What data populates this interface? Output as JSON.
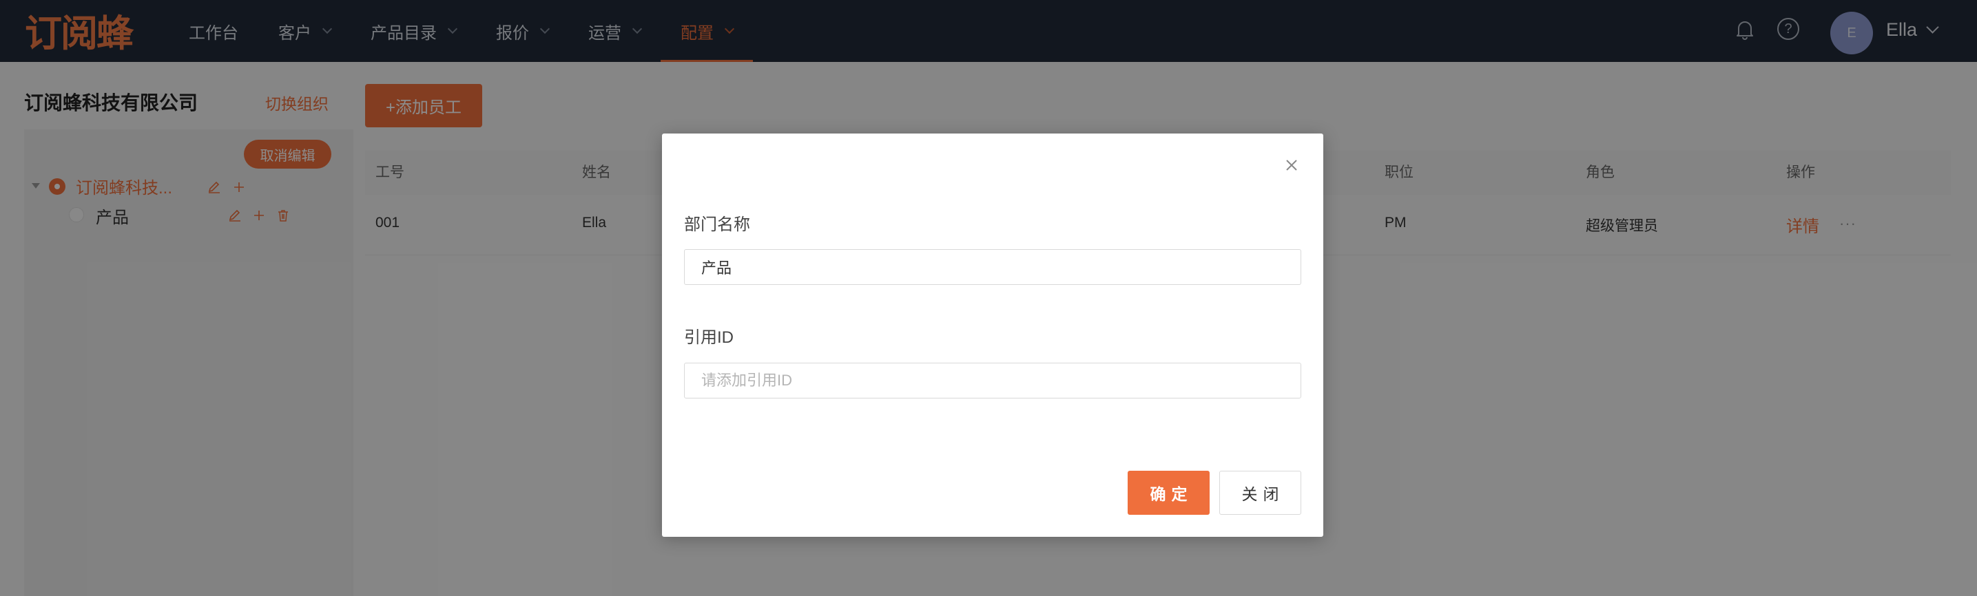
{
  "app": {
    "logo": "订阅蜂"
  },
  "nav": {
    "items": [
      {
        "label": "工作台"
      },
      {
        "label": "客户"
      },
      {
        "label": "产品目录"
      },
      {
        "label": "报价"
      },
      {
        "label": "运营"
      },
      {
        "label": "配置"
      }
    ]
  },
  "header": {
    "avatar_initial": "E",
    "username": "Ella",
    "help_glyph": "?"
  },
  "org": {
    "name": "订阅蜂科技有限公司",
    "switch_label": "切换组织",
    "cancel_edit_label": "取消编辑",
    "tree": {
      "root": "订阅蜂科技...",
      "child": "产品"
    }
  },
  "main": {
    "add_staff_label": "+添加员工",
    "columns": {
      "id": "工号",
      "name": "姓名",
      "position": "职位",
      "role": "角色",
      "actions": "操作"
    },
    "rows": [
      {
        "id": "001",
        "name": "Ella",
        "position": "PM",
        "role": "超级管理员",
        "detail": "详情",
        "more": "···"
      }
    ]
  },
  "modal": {
    "dept_label": "部门名称",
    "dept_value": "产品",
    "ref_label": "引用ID",
    "ref_placeholder": "请添加引用ID",
    "ok_label": "确定",
    "close_label": "关闭"
  },
  "colors": {
    "accent": "#ef6f3c",
    "nav_bg": "#222b3a"
  }
}
